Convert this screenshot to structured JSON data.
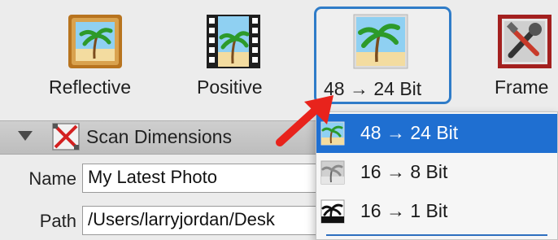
{
  "toolbar": {
    "items": [
      {
        "label": "Reflective",
        "icon": "reflective-photo-icon"
      },
      {
        "label": "Positive",
        "icon": "film-positive-icon"
      },
      {
        "label": "48 → 24 Bit",
        "icon": "color-depth-photo-icon",
        "selected": true
      },
      {
        "label": "Frame",
        "icon": "tools-frame-icon"
      }
    ]
  },
  "section": {
    "title": "Scan Dimensions",
    "icon": "crop-frame-icon"
  },
  "fields": {
    "name_label": "Name",
    "name_value": "My Latest Photo",
    "path_label": "Path",
    "path_value": "/Users/larryjordan/Desk"
  },
  "menu": {
    "items": [
      {
        "label": "48 → 24 Bit",
        "icon": "color-photo-icon",
        "highlighted": true
      },
      {
        "label": "16 → 8 Bit",
        "icon": "grayscale-photo-icon"
      },
      {
        "label": "16 → 1 Bit",
        "icon": "black-white-photo-icon"
      }
    ]
  },
  "colors": {
    "accent": "#2f7cc8",
    "highlight": "#1f6fd1",
    "arrow": "#e8231c"
  }
}
